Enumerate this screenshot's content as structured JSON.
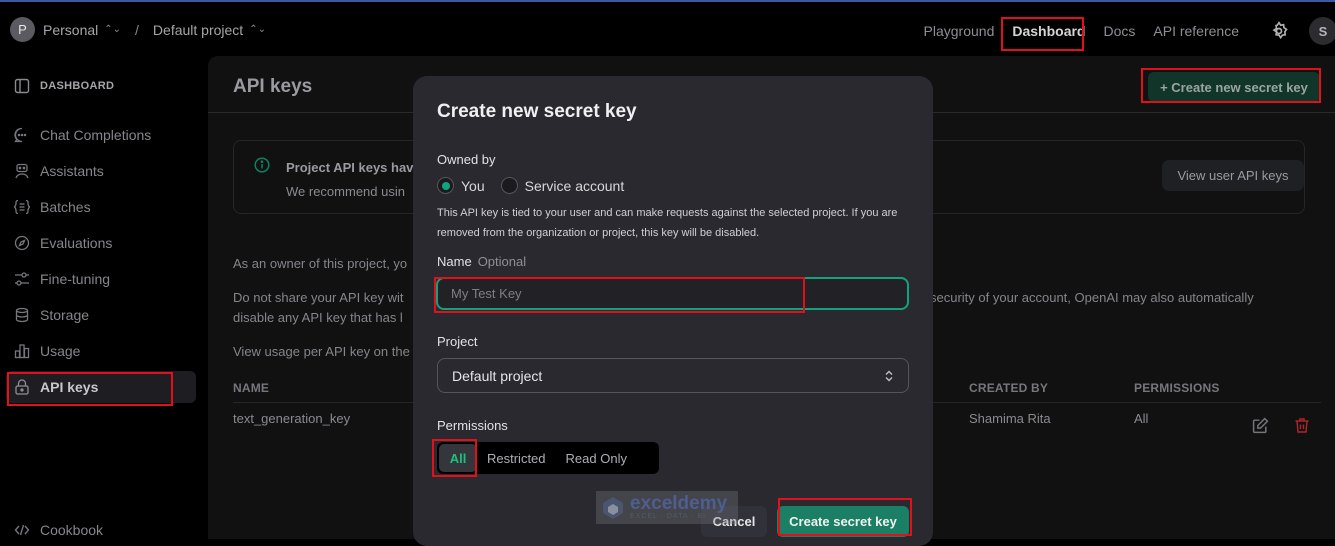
{
  "topbar": {
    "org_initial": "P",
    "org_name": "Personal",
    "separator": "/",
    "project_name": "Default project",
    "nav": [
      {
        "label": "Playground",
        "active": false
      },
      {
        "label": "Dashboard",
        "active": true
      },
      {
        "label": "Docs",
        "active": false
      },
      {
        "label": "API reference",
        "active": false
      }
    ],
    "settings_icon": "gear-icon",
    "user_initial": "S"
  },
  "sidebar": {
    "header": "DASHBOARD",
    "items": [
      {
        "label": "Chat Completions",
        "icon": "chat-bubble-icon"
      },
      {
        "label": "Assistants",
        "icon": "robot-icon"
      },
      {
        "label": "Batches",
        "icon": "braces-list-icon"
      },
      {
        "label": "Evaluations",
        "icon": "compass-icon"
      },
      {
        "label": "Fine-tuning",
        "icon": "sliders-icon"
      },
      {
        "label": "Storage",
        "icon": "database-icon"
      },
      {
        "label": "Usage",
        "icon": "bar-chart-icon"
      },
      {
        "label": "API keys",
        "icon": "lock-icon",
        "active": true
      }
    ],
    "footer_item": {
      "label": "Cookbook",
      "icon": "code-icon"
    }
  },
  "main": {
    "title": "API keys",
    "create_new_label": "+ Create new secret key",
    "notice": {
      "title": "Project API keys hav",
      "subtitle": "We recommend usin",
      "button": "View user API keys"
    },
    "paragraphs": {
      "p1": "As an owner of this project, yo",
      "p2_left_line1": "Do not share your API key wit",
      "p2_left_line2": "disable any API key that has l",
      "p2_right": "security of your account, OpenAI may also automatically",
      "p3": "View usage per API key on the"
    },
    "table": {
      "headers": {
        "name": "NAME",
        "created_by": "CREATED BY",
        "permissions": "PERMISSIONS"
      },
      "rows": [
        {
          "name": "text_generation_key",
          "created_by": "Shamima Rita",
          "permissions": "All"
        }
      ]
    }
  },
  "modal": {
    "title": "Create new secret key",
    "owned_by_label": "Owned by",
    "owner_options": [
      {
        "label": "You",
        "selected": true
      },
      {
        "label": "Service account",
        "selected": false
      }
    ],
    "help_text": "This API key is tied to your user and can make requests against the selected project. If you are removed from the organization or project, this key will be disabled.",
    "name_label": "Name",
    "name_optional": "Optional",
    "name_placeholder": "My Test Key",
    "name_value": "",
    "project_label": "Project",
    "project_value": "Default project",
    "permissions_label": "Permissions",
    "permission_options": [
      {
        "label": "All",
        "selected": true
      },
      {
        "label": "Restricted",
        "selected": false
      },
      {
        "label": "Read Only",
        "selected": false
      }
    ],
    "cancel_label": "Cancel",
    "create_label": "Create secret key"
  },
  "watermark": {
    "title": "exceldemy",
    "subtitle": "EXCEL · DATA · BI"
  },
  "colors": {
    "accent": "#10a37f",
    "highlight": "#e0111b",
    "danger": "#b4232a"
  }
}
